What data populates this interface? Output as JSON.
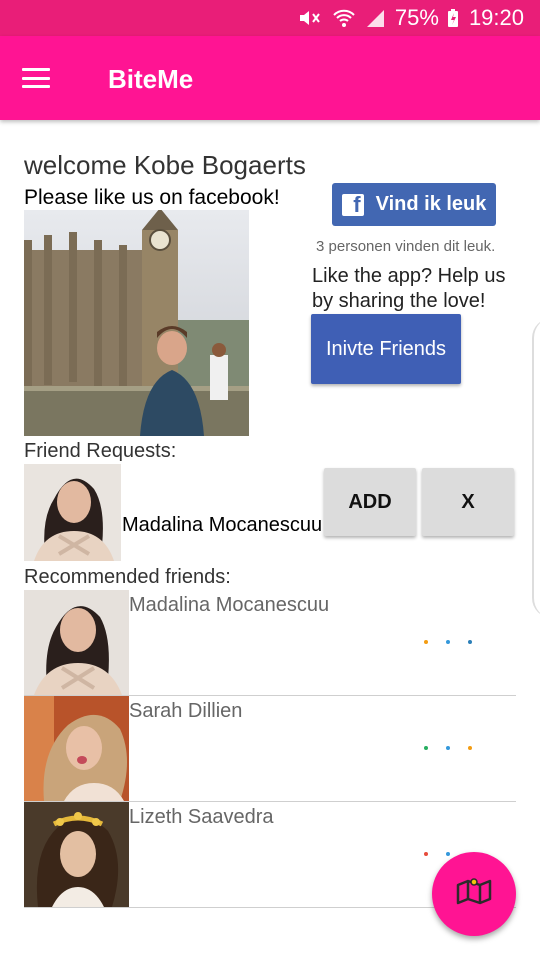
{
  "status_bar": {
    "battery": "75%",
    "time": "19:20"
  },
  "app_bar": {
    "title": "BiteMe"
  },
  "main": {
    "welcome": "welcome Kobe Bogaerts",
    "like_prompt": "Please like us on facebook!",
    "fb_like": {
      "label": "Vind ik leuk",
      "count_text": "3 personen vinden dit leuk."
    },
    "share_text": "Like the app? Help us by sharing the love!",
    "invite_label": "Inivte Friends"
  },
  "friend_requests": {
    "title": "Friend Requests:",
    "items": [
      {
        "name": "Madalina Mocanescuu"
      }
    ],
    "add_label": "ADD",
    "reject_label": "X"
  },
  "recommended": {
    "title": "Recommended friends:",
    "items": [
      {
        "name": "Madalina Mocanescuu"
      },
      {
        "name": "Sarah Dillien"
      },
      {
        "name": "Lizeth Saavedra"
      }
    ]
  },
  "colors": {
    "primary": "#ff1493",
    "status": "#e91e78",
    "facebook": "#4267b2",
    "invite": "#3f5fb5"
  },
  "icons": {
    "menu": "hamburger-icon",
    "fab": "map-icon"
  }
}
